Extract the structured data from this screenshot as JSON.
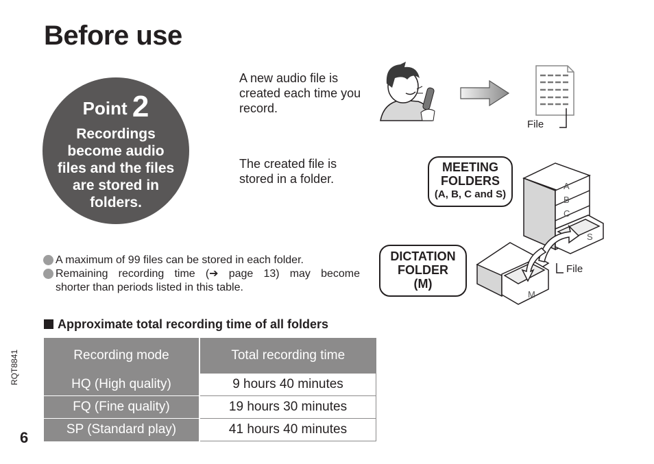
{
  "page": {
    "title": "Before use",
    "page_number": "6",
    "doc_code": "RQT8841"
  },
  "point": {
    "label": "Point",
    "number": "2",
    "description": "Recordings become audio files and the files are stored in folders."
  },
  "explanations": {
    "file_created": "A new audio file is created each time you record.",
    "file_stored": "The created file is stored in a folder."
  },
  "illustrations": {
    "file_label": "File",
    "meeting_folders": {
      "line1": "MEETING",
      "line2": "FOLDERS",
      "line3": "(A, B, C and S)",
      "drawer_labels": [
        "A",
        "B",
        "C",
        "S"
      ]
    },
    "dictation_folder": {
      "line1": "DICTATION",
      "line2": "FOLDER",
      "line3": "(M)",
      "drawer_label": "M"
    }
  },
  "notes": {
    "note1": "A maximum of 99 files can be stored in each folder.",
    "note2_line1": "Remaining recording time (➔ page 13) may become",
    "note2_line2": "shorter than periods listed in this table."
  },
  "recording_table": {
    "section_title": "Approximate total recording time of all folders",
    "headers": [
      "Recording mode",
      "Total recording time"
    ],
    "rows": [
      {
        "mode": "HQ (High quality)",
        "time": "9 hours 40 minutes"
      },
      {
        "mode": "FQ (Fine quality)",
        "time": "19 hours 30 minutes"
      },
      {
        "mode": "SP (Standard play)",
        "time": "41 hours 40 minutes"
      }
    ]
  }
}
